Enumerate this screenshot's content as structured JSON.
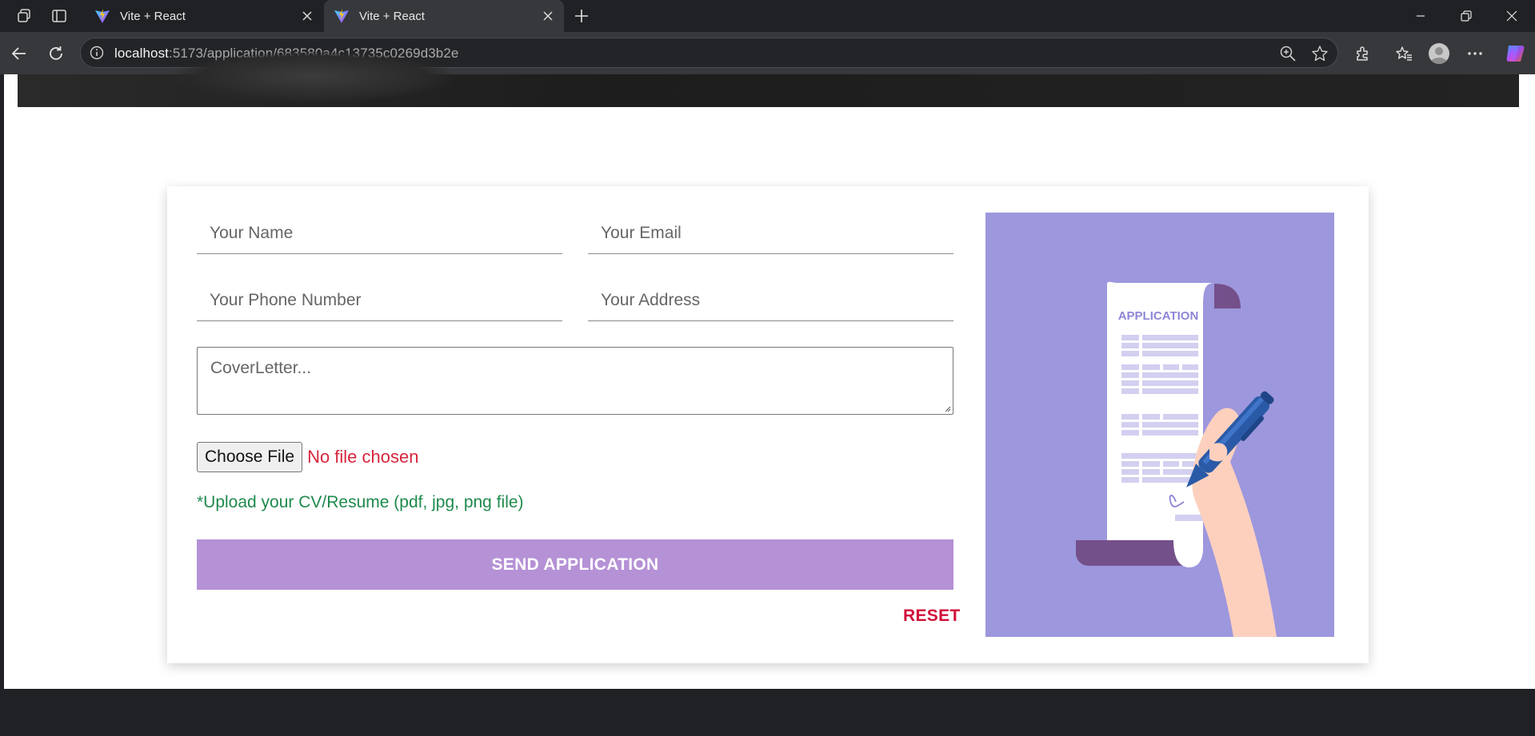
{
  "browser": {
    "tabs": [
      {
        "title": "Vite + React",
        "active": false
      },
      {
        "title": "Vite + React",
        "active": true
      }
    ],
    "address": {
      "host": "localhost",
      "path": ":5173/application/683580a4c13735c0269d3b2e"
    }
  },
  "form": {
    "name_placeholder": "Your Name",
    "email_placeholder": "Your Email",
    "phone_placeholder": "Your Phone Number",
    "address_placeholder": "Your Address",
    "cover_placeholder": "CoverLetter...",
    "choose_file_label": "Choose File",
    "no_file_text": "No file chosen",
    "upload_hint": "*Upload your CV/Resume (pdf, jpg, png file)",
    "submit_label": "SEND APPLICATION",
    "reset_label": "RESET"
  },
  "illustration": {
    "document_title": "APPLICATION"
  },
  "colors": {
    "submit_bg": "#b591d6",
    "reset_text": "#d10f3a",
    "no_file_text": "#d7263d",
    "hint_text": "#1f8a4c",
    "illustration_bg": "#9d97dd"
  }
}
